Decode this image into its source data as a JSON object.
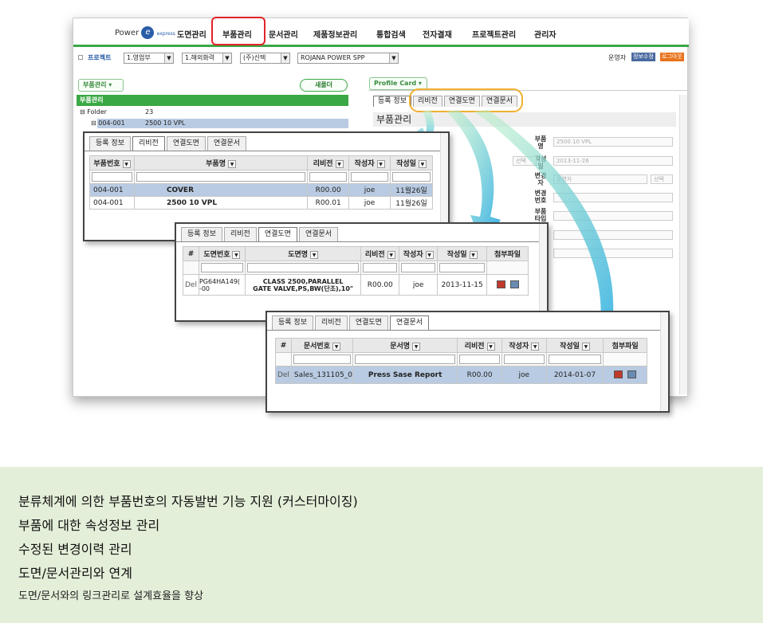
{
  "nav": {
    "logo": "Power",
    "logo_sub": "express",
    "items": [
      "도면관리",
      "부품관리",
      "문서관리",
      "제품정보관리",
      "통합검색",
      "전자결재",
      "프로젝트관리",
      "관리자"
    ]
  },
  "filter": {
    "project_label": "프로젝트",
    "sel1": "1.영업부",
    "sel2": "1.해외화력",
    "sel3": "(주)신텍",
    "sel4": "ROJANA POWER SPP",
    "user": "운영자",
    "btn_info": "정보수정",
    "btn_logout": "로그아웃"
  },
  "left": {
    "dropdown": "부품관리",
    "new_folder": "새폴더",
    "bar": "부품관리",
    "tree": [
      {
        "name": "Folder",
        "count": "23"
      },
      {
        "name": "004-001",
        "count": "2500 10 VPL"
      }
    ]
  },
  "right": {
    "dropdown": "Profile Card",
    "tabs": [
      "등록 정보",
      "리비전",
      "연결도면",
      "연결문서"
    ],
    "title": "부품관리",
    "labels": [
      "부품명",
      "작성일",
      "변경자",
      "변경번호",
      "부품타입"
    ],
    "field_name": "2500 10 VPL",
    "field_date": "2013-11-26",
    "field_changer": "운영자",
    "btn_select": "선택"
  },
  "win1": {
    "tabs": [
      "등록 정보",
      "리비전",
      "연결도면",
      "연결문서"
    ],
    "headers": [
      "부품번호",
      "부품명",
      "리비전",
      "작성자",
      "작성일"
    ],
    "rows": [
      [
        "004-001",
        "COVER",
        "R00.00",
        "joe",
        "11월26일"
      ],
      [
        "004-001",
        "2500 10 VPL",
        "R00.01",
        "joe",
        "11월26일"
      ]
    ]
  },
  "win2": {
    "tabs": [
      "등록 정보",
      "리비전",
      "연결도면",
      "연결문서"
    ],
    "headers": [
      "#",
      "도면번호",
      "도면명",
      "리비전",
      "작성자",
      "작성일",
      "첨부파일"
    ],
    "row": [
      "Del",
      "PG64HA149(\n-00",
      "CLASS 2500,PARALLEL\nGATE VALVE,PS,BW(단조),10\"",
      "R00.00",
      "joe",
      "2013-11-15"
    ]
  },
  "win3": {
    "tabs": [
      "등록 정보",
      "리비전",
      "연결도면",
      "연결문서"
    ],
    "headers": [
      "#",
      "문서번호",
      "문서명",
      "리비전",
      "작성자",
      "작성일",
      "첨부파일"
    ],
    "row": [
      "Del",
      "Sales_131105_0",
      "Press Sase Report",
      "R00.00",
      "joe",
      "2014-01-07"
    ]
  },
  "features": {
    "line1": "분류체계에 의한 부품번호의 자동발번 기능 지원 (커스터마이징)",
    "line2": "부품에 대한 속성정보 관리",
    "line3": "수정된 변경이력 관리",
    "line4": "도면/문서관리와 연계",
    "line5": "도면/문서와의 링크관리로 설계효율을 향상"
  }
}
